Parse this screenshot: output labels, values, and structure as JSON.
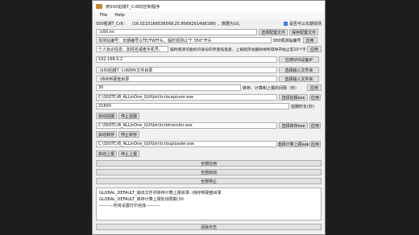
{
  "window": {
    "title": "用S50拍摄T_Cr8的控制程序"
  },
  "menu": {
    "file": "File",
    "help": "Help"
  },
  "coords": {
    "label": "S50视测T_Cr8：",
    "value": "(16.0110166536569,25.8569291498168)",
    "hint": "，数据为10。",
    "checkbox_label": "是否可以长期观测",
    "checkbox_checked": true
  },
  "config": {
    "path": ".\\s50.ini",
    "select_button": "选择配置文件",
    "save_button": "保存配置文件"
  },
  "observation": {
    "field": "观测站编号：长期编号以TE/TW开头，临时观测以\"T_S50\"开头",
    "label": "S50观测站编号",
    "apply": "应用"
  },
  "personal": {
    "field": "个人标识信息：如姓名或者手机号。",
    "note": "临时观测可能标识身份的尽量低值意，上报程序会删除将所得导开始止前10个字符",
    "apply": "应用"
  },
  "ip": {
    "value": "192.168.0.2",
    "button": "应用S50设备IP"
  },
  "input_dir": {
    "path": ".\\S50拍摄T_Cr8的fit文件目录",
    "button": "选择输入文件夹"
  },
  "output_dir": {
    "path": ".\\待存到硬盘目录",
    "button": "选择输入文件夹"
  },
  "interval": {
    "value": "30",
    "label": "转存、计算和上报的间隔（秒）",
    "apply": "应用"
  },
  "capturer": {
    "path": "C:\\S50TCrB_ALLinOne_GUI\\bin\\tcrbcapturer.exe",
    "button": "选择拍摄exe",
    "apply": "应用"
  },
  "capture_duration": {
    "value": "21600",
    "label": "拍摄时长(秒)"
  },
  "capture_controls": {
    "start": "启动拍摄",
    "stop": "停止拍摄"
  },
  "transfer": {
    "path": "C:\\S50TCrB_ALLinOne_GUI\\bin\\tcrbtransfer.exe",
    "button": "选择转存exe",
    "apply": "应用"
  },
  "transfer_controls": {
    "start": "启动转存",
    "stop": "停止转存"
  },
  "uploader": {
    "path": "C:\\S50TCrB_ALLinOne_GUI\\bin\\tcrbuploader.exe",
    "button": "选择计算上报exe",
    "apply": "应用"
  },
  "upload_controls": {
    "start": "启动上报",
    "stop": "停止上报"
  },
  "all": {
    "apply": "全部应用",
    "start": "全部启动",
    "stop": "全部停止"
  },
  "log": {
    "lines": [
      "GLOBAL_DEFAULT_输出文件共转存计算上报目录:.\\待存到硬盘目录",
      "GLOBAL_DEFAULT_转存计算上报轮询周期:30",
      "----------所有设置打印完成----------"
    ],
    "clear_button": "清除日志"
  }
}
